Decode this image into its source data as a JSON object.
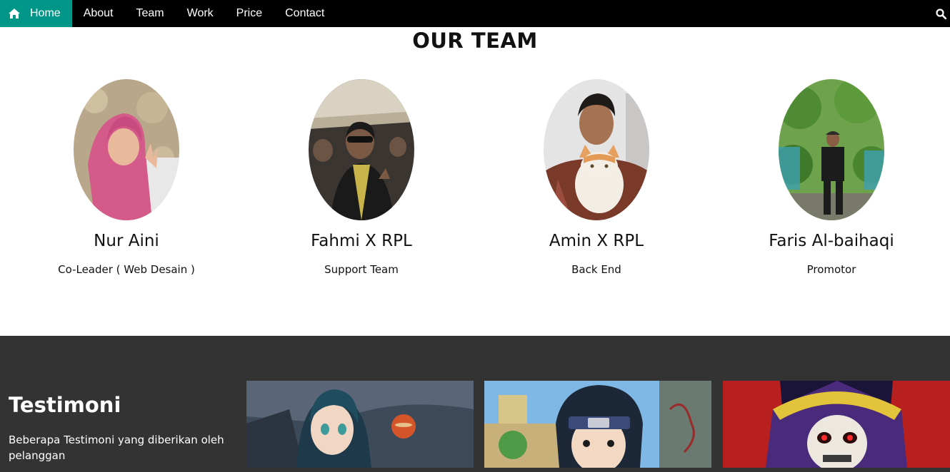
{
  "nav": {
    "items": [
      {
        "label": "Home",
        "active": true
      },
      {
        "label": "About",
        "active": false
      },
      {
        "label": "Team",
        "active": false
      },
      {
        "label": "Work",
        "active": false
      },
      {
        "label": "Price",
        "active": false
      },
      {
        "label": "Contact",
        "active": false
      }
    ],
    "search_icon": "search-icon",
    "home_icon": "home-icon"
  },
  "team": {
    "title": "OUR TEAM",
    "members": [
      {
        "name": "Nur Aini",
        "role": "Co-Leader ( Web Desain )"
      },
      {
        "name": "Fahmi X RPL",
        "role": "Support Team"
      },
      {
        "name": "Amin X RPL",
        "role": "Back End"
      },
      {
        "name": "Faris Al-baihaqi",
        "role": "Promotor"
      }
    ]
  },
  "testimoni": {
    "title": "Testimoni",
    "description": "Beberapa Testimoni yang diberikan oleh pelanggan"
  },
  "colors": {
    "nav_bg": "#000000",
    "active": "#009688",
    "section_dark": "#333333"
  }
}
